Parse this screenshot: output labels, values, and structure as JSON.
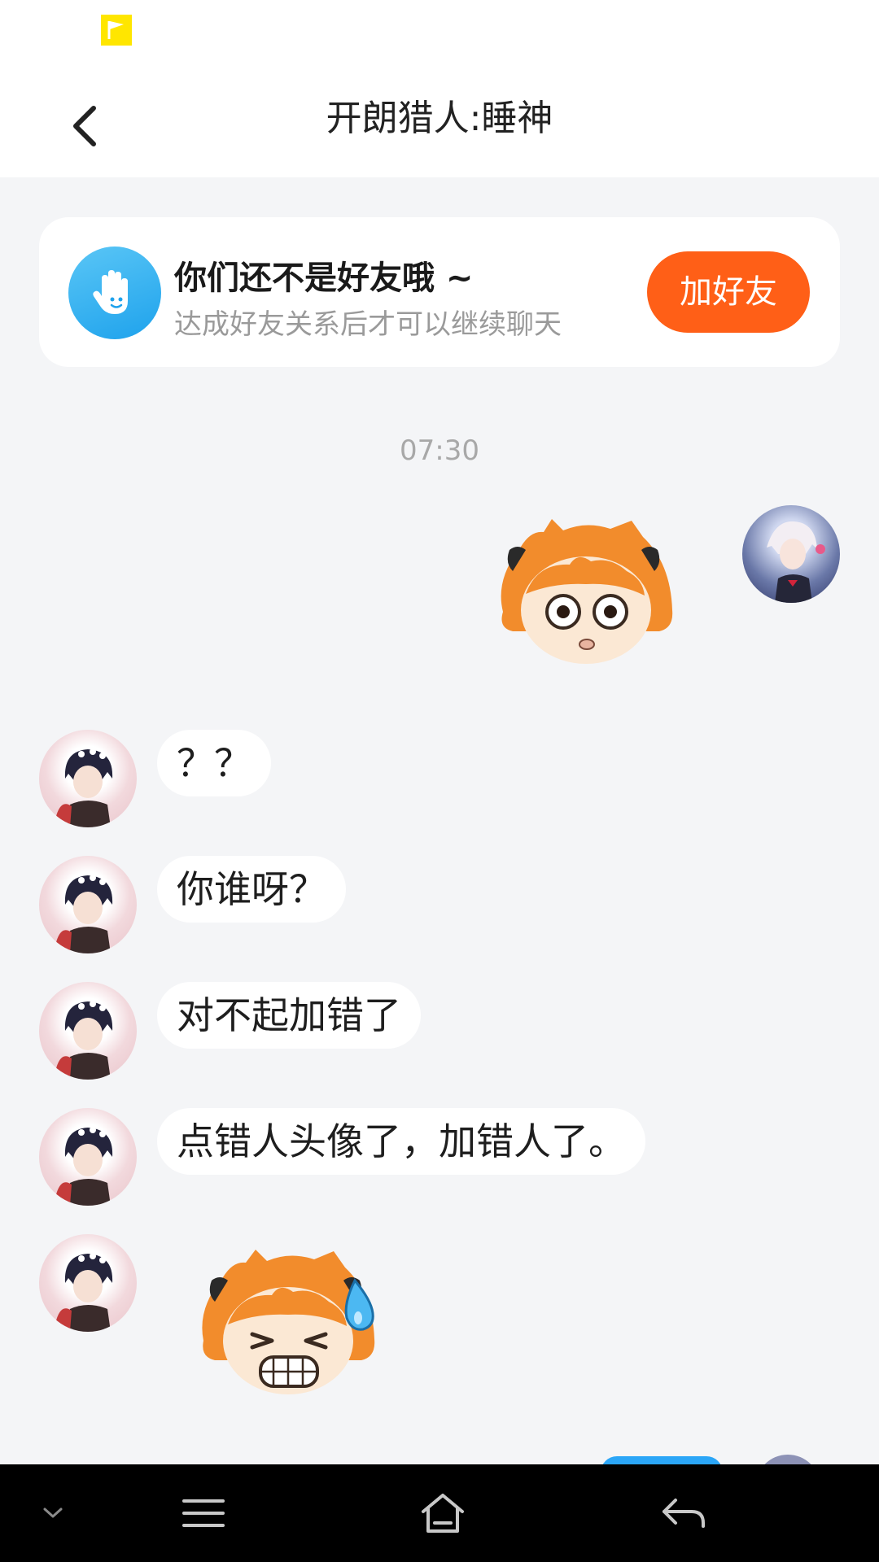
{
  "header": {
    "title": "开朗猎人:睡神"
  },
  "banner": {
    "title": "你们还不是好友哦 ~",
    "subtitle": "达成好友关系后才可以继续聊天",
    "add_button": "加好友"
  },
  "chat": {
    "timestamp": "07:30",
    "messages": [
      {
        "from": "other",
        "text": "？？"
      },
      {
        "from": "other",
        "text": "你谁呀？"
      },
      {
        "from": "other",
        "text": "对不起加错了"
      },
      {
        "from": "other",
        "text": "点错人头像了，加错人了。"
      }
    ]
  },
  "colors": {
    "accent": "#ff5f17",
    "banner_icon": "#1ea2ec",
    "background": "#f4f5f7",
    "nav_bar": "#000000"
  },
  "icons": {
    "status": "yellow-flag-icon",
    "back": "chevron-left-icon",
    "banner": "waving-hand-icon",
    "nav": [
      "chevron-down-icon",
      "menu-icon",
      "home-icon",
      "back-arrow-icon"
    ]
  }
}
